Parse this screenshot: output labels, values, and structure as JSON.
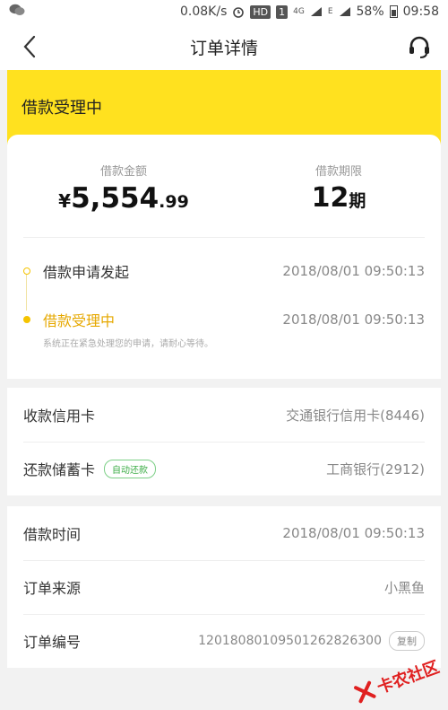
{
  "status_bar": {
    "network_speed": "0.08K/s",
    "hd_badge": "HD",
    "sim_badge": "1",
    "network_type": "4G",
    "edge_indicator": "E",
    "battery": "58%",
    "time": "09:58",
    "icons": [
      "wechat-icon",
      "alarm-icon",
      "signal-icon",
      "battery-icon"
    ]
  },
  "nav": {
    "title": "订单详情",
    "back_icon": "chevron-left-icon",
    "support_icon": "headset-icon"
  },
  "banner": {
    "status_text": "借款受理中",
    "color": "#ffe11f"
  },
  "summary": {
    "amount_label": "借款金额",
    "amount_currency": "¥",
    "amount_integer": "5,554",
    "amount_decimal": ".99",
    "term_label": "借款期限",
    "term_value": "12",
    "term_unit": "期"
  },
  "timeline": {
    "steps": [
      {
        "label": "借款申请发起",
        "time": "2018/08/01 09:50:13"
      },
      {
        "label": "借款受理中",
        "time": "2018/08/01 09:50:13"
      }
    ],
    "note": "系统正在紧急处理您的申请，请耐心等待。",
    "accent_color": "#f5c400"
  },
  "cards": {
    "receive_label": "收款信用卡",
    "receive_value": "交通银行信用卡(8446)",
    "repay_label": "还款储蓄卡",
    "repay_tag": "自动还款",
    "repay_value": "工商银行(2912)"
  },
  "order": {
    "time_label": "借款时间",
    "time_value": "2018/08/01 09:50:13",
    "source_label": "订单来源",
    "source_value": "小黑鱼",
    "number_label": "订单编号",
    "number_value": "1201808010950126282630​0",
    "copy_label": "复制"
  },
  "watermark": {
    "text": "卡农社区"
  }
}
